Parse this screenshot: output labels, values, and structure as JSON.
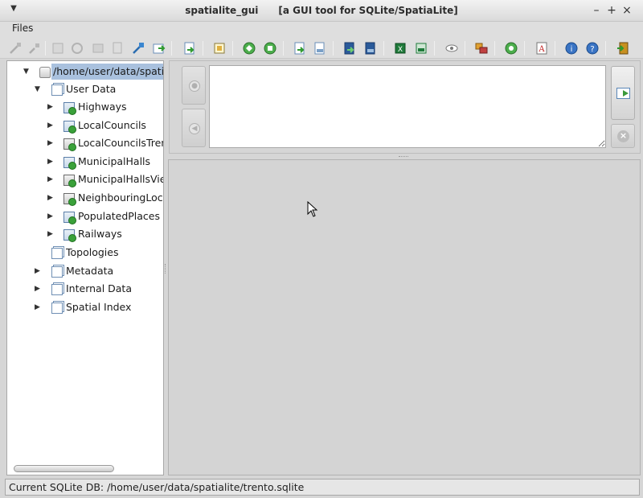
{
  "window": {
    "app_title": "spatialite_gui",
    "subtitle": "[a GUI tool for SQLite/SpatiaLite]",
    "menu_icon": "chevron-down-icon",
    "controls": [
      "minimize",
      "maximize",
      "close"
    ]
  },
  "menubar": {
    "items": [
      "Files"
    ]
  },
  "toolbar": {
    "buttons": [
      {
        "icon": "connect-icon",
        "enabled": false
      },
      {
        "icon": "disconnect-icon",
        "enabled": false
      },
      {
        "icon": "create-db-icon",
        "enabled": false
      },
      {
        "icon": "memory-db-icon",
        "enabled": false
      },
      {
        "icon": "vacuum-icon",
        "enabled": false
      },
      {
        "icon": "sql-script-icon",
        "enabled": false
      },
      {
        "icon": "attach-db-icon",
        "enabled": true
      },
      {
        "icon": "execute-script-icon",
        "enabled": true
      },
      {
        "icon": "load-shapefile-icon",
        "enabled": true
      },
      {
        "icon": "virtual-shapefile-icon",
        "enabled": true
      },
      {
        "icon": "network-icon",
        "enabled": true
      },
      {
        "icon": "exif-icon",
        "enabled": true
      },
      {
        "icon": "load-txt-icon",
        "enabled": true
      },
      {
        "icon": "virtual-txt-icon",
        "enabled": true
      },
      {
        "icon": "load-dbf-icon",
        "enabled": true
      },
      {
        "icon": "virtual-dbf-icon",
        "enabled": true
      },
      {
        "icon": "load-xls-icon",
        "enabled": true
      },
      {
        "icon": "virtual-xls-icon",
        "enabled": true
      },
      {
        "icon": "srids-icon",
        "enabled": true
      },
      {
        "icon": "map-icon",
        "enabled": true
      },
      {
        "icon": "check-geometry-icon",
        "enabled": true
      },
      {
        "icon": "charset-icon",
        "enabled": true
      },
      {
        "icon": "help-icon",
        "enabled": true
      },
      {
        "icon": "about-icon",
        "enabled": true
      },
      {
        "icon": "exit-icon",
        "enabled": true
      }
    ]
  },
  "tree": {
    "root": "/home/user/data/spatialite/trento.sqlite",
    "user_data": {
      "label": "User Data",
      "tables": [
        {
          "label": "Highways",
          "kind": "table"
        },
        {
          "label": "LocalCouncils",
          "kind": "table"
        },
        {
          "label": "LocalCouncilsTrento",
          "kind": "view"
        },
        {
          "label": "MunicipalHalls",
          "kind": "table"
        },
        {
          "label": "MunicipalHallsView",
          "kind": "view"
        },
        {
          "label": "NeighbouringLocalCouncils",
          "kind": "view"
        },
        {
          "label": "PopulatedPlaces",
          "kind": "table"
        },
        {
          "label": "Railways",
          "kind": "table"
        }
      ]
    },
    "topologies": "Topologies",
    "metadata": "Metadata",
    "internal_data": "Internal Data",
    "spatial_index": "Spatial Index"
  },
  "sql_panel": {
    "query_text": "",
    "history_back_icon": "history-back-icon",
    "history_forward_icon": "history-forward-icon",
    "execute_icon": "execute-sql-icon",
    "clear_icon": "clear-icon"
  },
  "statusbar": {
    "text": "Current SQLite DB: /home/user/data/spatialite/trento.sqlite"
  }
}
